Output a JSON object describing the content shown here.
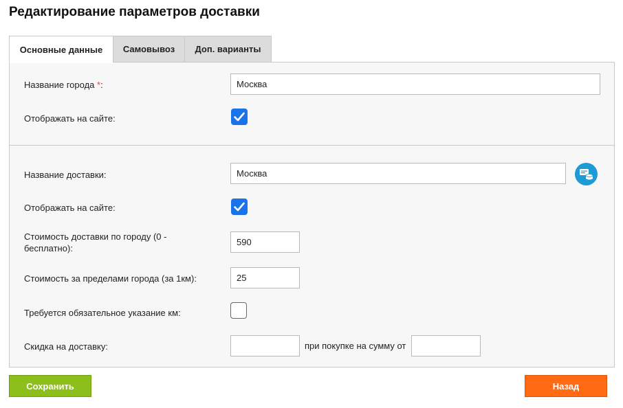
{
  "page": {
    "title": "Редактирование параметров доставки"
  },
  "tabs": [
    {
      "label": "Основные данные",
      "active": true
    },
    {
      "label": "Самовывоз",
      "active": false
    },
    {
      "label": "Доп. варианты",
      "active": false
    }
  ],
  "city_section": {
    "city_name_label": "Название города",
    "required_mark": "*",
    "label_suffix": ":",
    "city_name_value": "Москва",
    "show_on_site_label": "Отображать на сайте:",
    "show_on_site_checked": true
  },
  "delivery_section": {
    "delivery_name_label": "Название доставки:",
    "delivery_name_value": "Москва",
    "translit_icon": "transliterate-icon",
    "show_on_site_label": "Отображать на сайте:",
    "show_on_site_checked": true,
    "city_cost_label": "Стоимость доставки по городу (0 - бесплатно):",
    "city_cost_value": "590",
    "outside_cost_label": "Стоимость за пределами города (за 1км):",
    "outside_cost_value": "25",
    "km_required_label": "Требуется обязательное указание км:",
    "km_required_checked": false,
    "discount_label": "Скидка на доставку:",
    "discount_value": "",
    "min_purchase_text": "при покупке на сумму от",
    "min_purchase_value": ""
  },
  "actions": {
    "save_label": "Сохранить",
    "back_label": "Назад"
  },
  "colors": {
    "accent": "#1a73e8",
    "save": "#8cbf1a",
    "back": "#ff6a13",
    "translit": "#1e9ad6",
    "required": "#e04a2c"
  }
}
